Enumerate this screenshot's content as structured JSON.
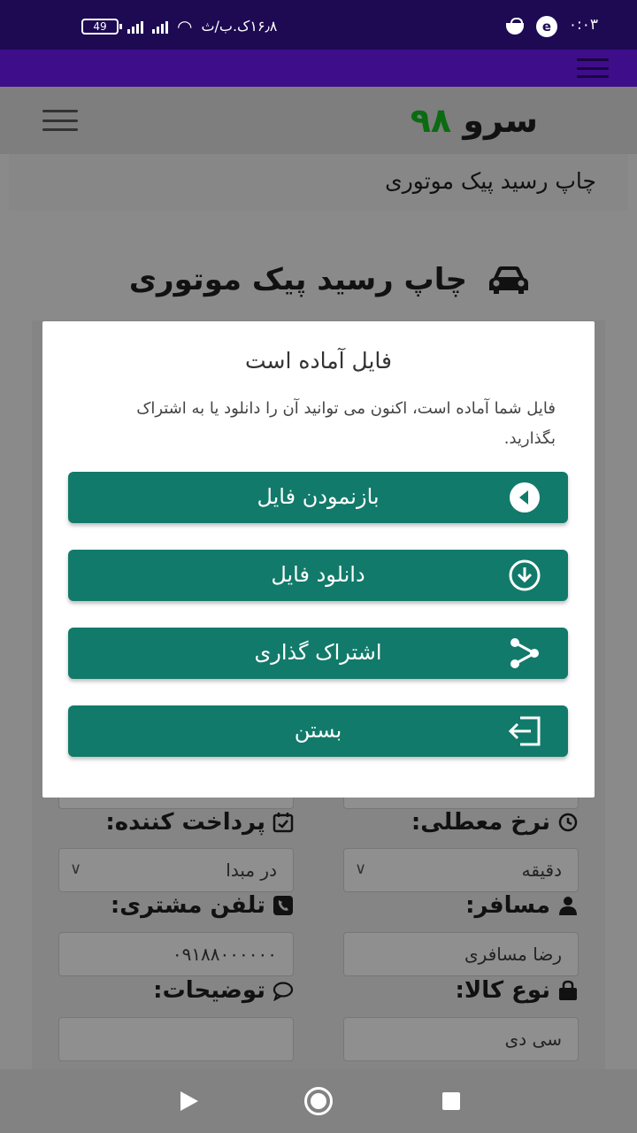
{
  "status_bar": {
    "time": "۰:۰۳",
    "clock": "۱۶٫۸ک.ب/ث",
    "battery": "49",
    "app_icon_letter": "e"
  },
  "header": {
    "logo_word": "سرو",
    "logo_number": "۹۸"
  },
  "breadcrumb": "چاپ رسید پیک موتوری",
  "page_title": "چاپ رسید پیک موتوری",
  "form": {
    "payer_label": "پرداخت کننده:",
    "payer_value": "در مبدا",
    "rate_label": "نرخ معطلی:",
    "rate_value": "دقیقه",
    "customer_phone_label": "تلفن مشتری:",
    "customer_phone_value": "۰۹۱۸۸۰۰۰۰۰۰",
    "passenger_label": "مسافر:",
    "passenger_value": "رضا مسافری",
    "notes_label": "توضیحات:",
    "notes_value": "",
    "goods_type_label": "نوع کالا:",
    "goods_type_value": "سی دی"
  },
  "modal": {
    "title": "فایل آماده است",
    "message": "فایل شما آماده است، اکنون می توانید آن را دانلود یا به اشتراک بگذارید.",
    "buttons": {
      "open": "بازنمودن فایل",
      "download": "دانلود فایل",
      "share": "اشتراک گذاری",
      "close": "بستن"
    }
  },
  "colors": {
    "button": "#127a6a",
    "status_bar": "#1d0a52",
    "app_bar": "#3d0d8a",
    "logo_number": "#0b6b12"
  }
}
